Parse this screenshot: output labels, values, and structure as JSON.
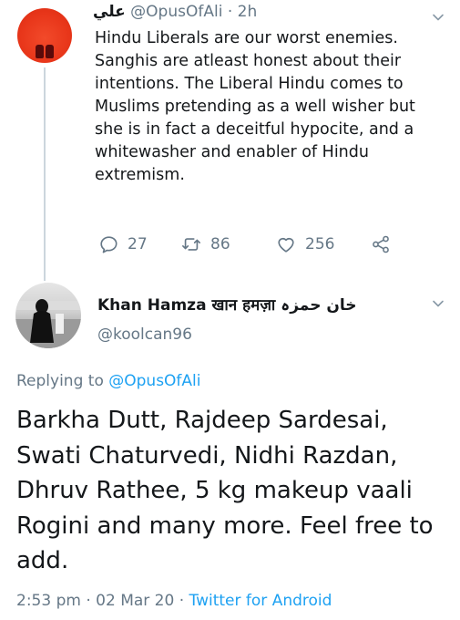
{
  "parent_tweet": {
    "display_name": "علي",
    "handle": "@OpusOfAli",
    "separator": "·",
    "time": "2h",
    "text": "Hindu Liberals are our worst enemies. Sanghis are atleast honest about their intentions. The Liberal Hindu comes to Muslims pretending as a well wisher but she is in fact a deceitful hypocite, and a whitewasher and enabler of Hindu extremism.",
    "replies": "27",
    "retweets": "86",
    "likes": "256"
  },
  "main_tweet": {
    "display_name": "Khan Hamza खान हमज़ा خان حمزہ",
    "handle": "@koolcan96",
    "replying_prefix": "Replying to",
    "replying_to": "@OpusOfAli",
    "text": "Barkha Dutt, Rajdeep Sardesai, Swati Chaturvedi, Nidhi Razdan, Dhruv Rathee, 5 kg makeup vaali Rogini and many more. Feel free to add.",
    "time": "2:53 pm",
    "date": "02 Mar 20",
    "separator": "·",
    "source": "Twitter for Android"
  },
  "icons": [
    "chevron-down-icon",
    "reply-icon",
    "retweet-icon",
    "like-icon",
    "share-icon"
  ],
  "colors": {
    "link": "#1da1f2",
    "muted": "#657786",
    "text": "#14171a"
  }
}
